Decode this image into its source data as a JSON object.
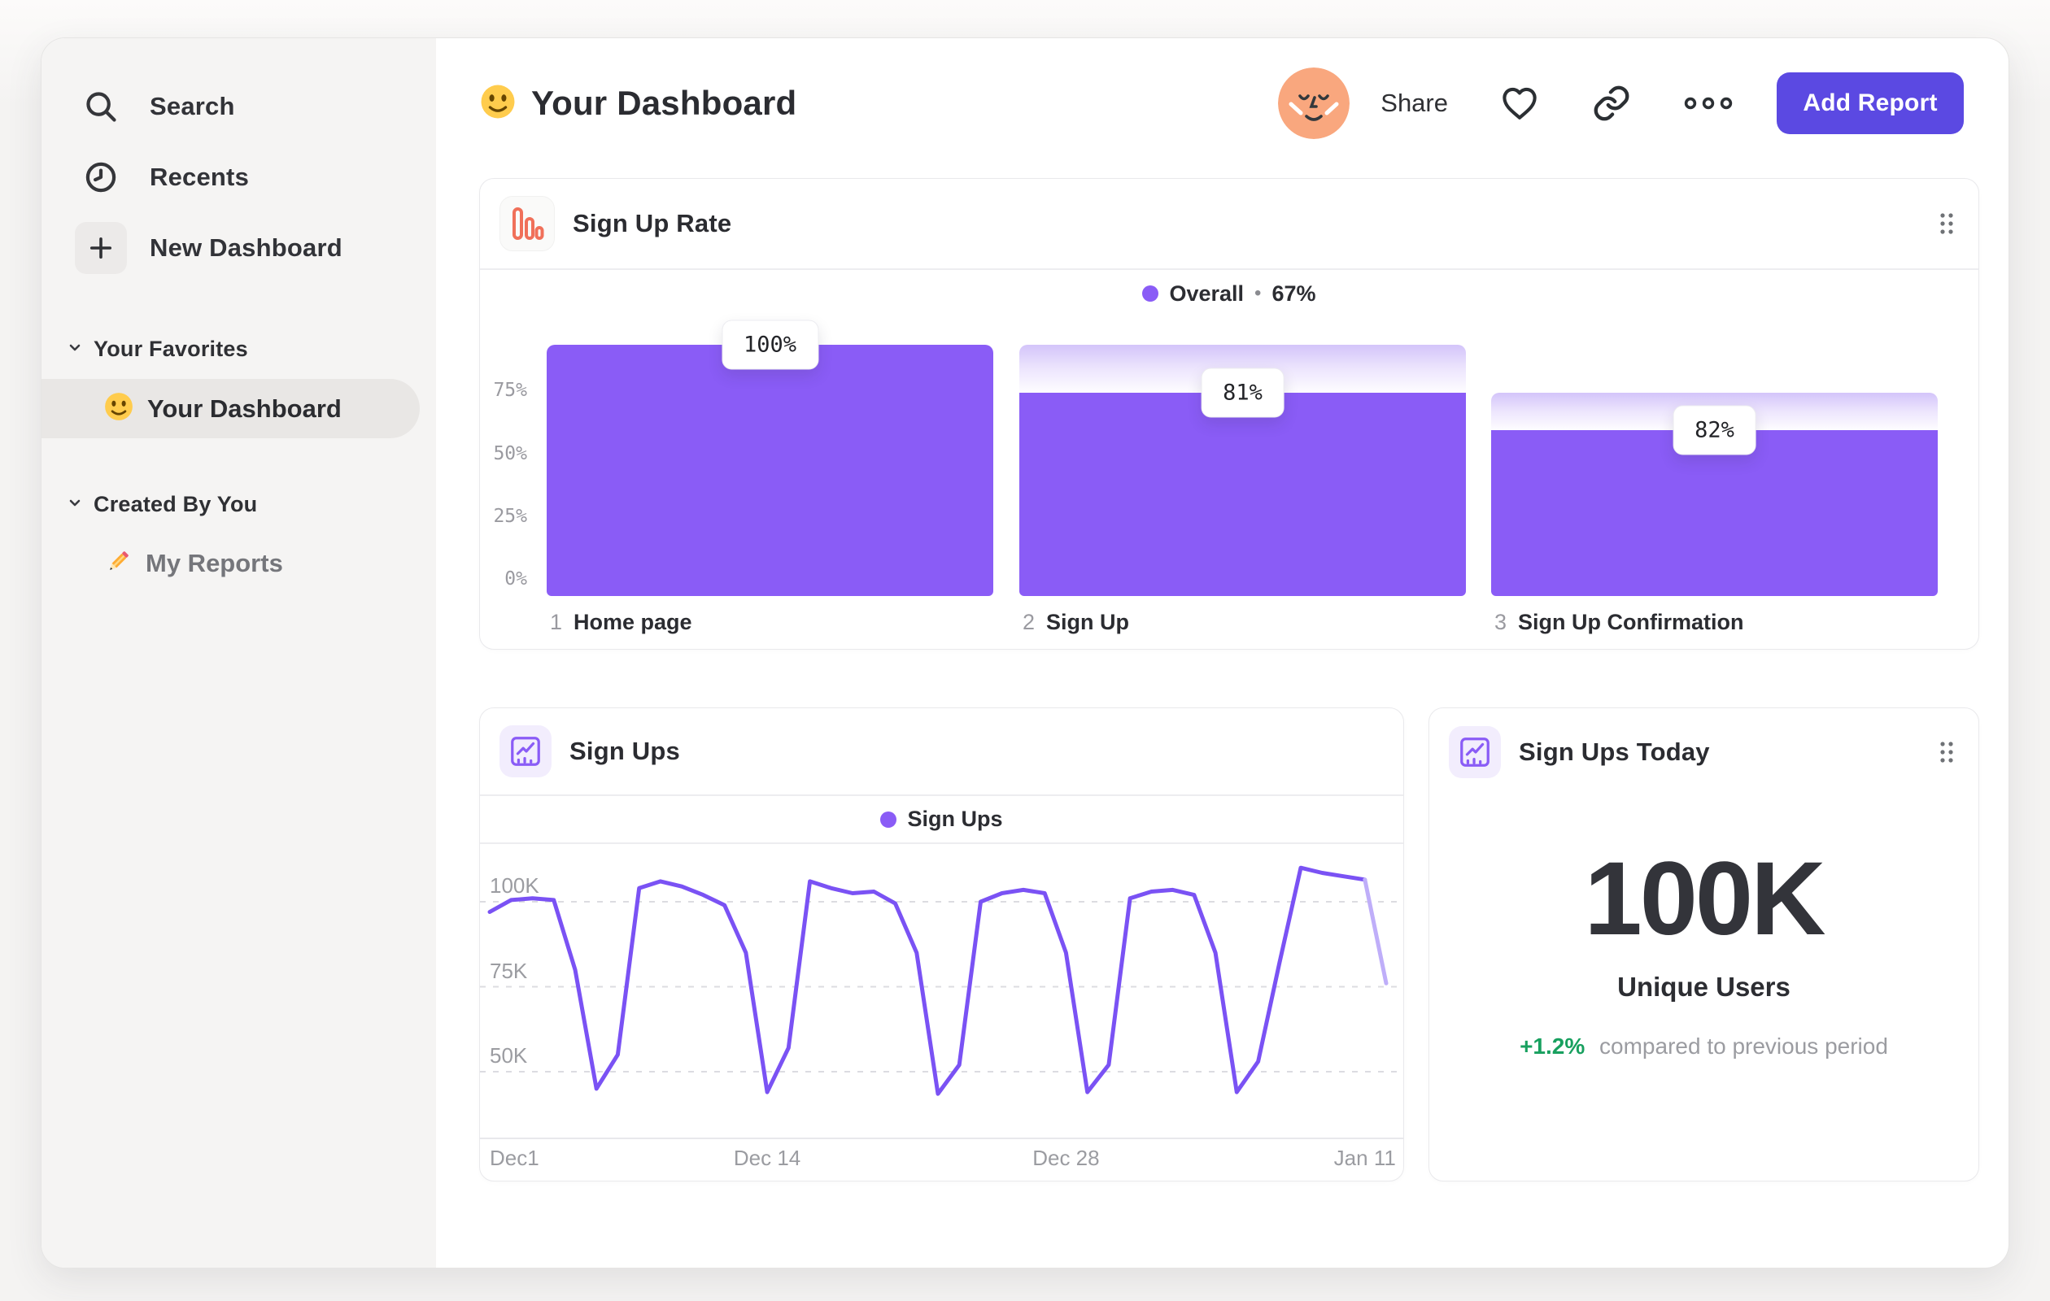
{
  "sidebar": {
    "items": [
      {
        "label": "Search",
        "icon": "search-icon"
      },
      {
        "label": "Recents",
        "icon": "clock-icon"
      },
      {
        "label": "New Dashboard",
        "icon": "plus-icon"
      }
    ],
    "sections": [
      {
        "title": "Your Favorites",
        "items": [
          {
            "label": "Your Dashboard",
            "emoji": "smiley",
            "selected": true
          }
        ]
      },
      {
        "title": "Created By You",
        "items": [
          {
            "label": "My Reports",
            "emoji": "pencil",
            "selected": false
          }
        ]
      }
    ]
  },
  "header": {
    "title": "Your Dashboard",
    "share_label": "Share",
    "add_report_label": "Add Report"
  },
  "cards": {
    "funnel": {
      "title": "Sign Up Rate",
      "legend": {
        "label": "Overall",
        "sep": "•",
        "value": "67%"
      }
    },
    "line": {
      "title": "Sign Ups",
      "legend": {
        "label": "Sign Ups"
      }
    },
    "metric": {
      "title": "Sign Ups Today",
      "value": "100K",
      "label": "Unique Users",
      "delta": "+1.2%",
      "delta_note": "compared to previous period"
    }
  },
  "chart_data": [
    {
      "type": "bar",
      "subtype": "funnel",
      "title": "Sign Up Rate",
      "legend": "Overall • 67%",
      "overall_pct": 67,
      "steps": [
        {
          "step": 1,
          "label": "Home page",
          "conversion_pct": 100,
          "cumulative_pct": 100
        },
        {
          "step": 2,
          "label": "Sign Up",
          "conversion_pct": 81,
          "cumulative_pct": 81
        },
        {
          "step": 3,
          "label": "Sign Up Confirmation",
          "conversion_pct": 82,
          "cumulative_pct": 66
        }
      ],
      "yticks": [
        "75%",
        "50%",
        "25%",
        "0%"
      ],
      "ytick_values": [
        75,
        50,
        25,
        0
      ],
      "ylim": [
        0,
        100
      ],
      "bar_color": "#8A5CF6",
      "dropoff_gradient": [
        "#D3C4FA",
        "#FFFFFF"
      ]
    },
    {
      "type": "line",
      "title": "Sign Ups",
      "series": [
        {
          "name": "Sign Ups",
          "values_thousands": [
            97,
            100.5,
            101,
            100.5,
            80,
            45,
            55,
            104,
            106,
            104.5,
            102,
            99,
            85,
            44,
            57,
            106,
            104,
            102.5,
            103,
            99.5,
            85,
            43.5,
            52,
            100,
            102.5,
            103.5,
            102.5,
            85,
            44,
            52,
            101,
            103,
            103.5,
            102,
            85,
            44,
            53,
            82,
            110,
            108.5,
            107.5,
            106.5,
            76
          ]
        }
      ],
      "x_tick_labels": [
        "Dec1",
        "Dec 14",
        "Dec 28",
        "Jan 11"
      ],
      "x_tick_positions": [
        0,
        13,
        27,
        41
      ],
      "yticks": [
        "100K",
        "75K",
        "50K"
      ],
      "ytick_values": [
        100,
        75,
        50
      ],
      "unit": "thousands",
      "grid": "dashed-horizontal",
      "line_color": "#7A52F4",
      "faded_tail_color": "#BFAEF9",
      "faded_tail_points": 1,
      "legend_position": "top-center"
    }
  ],
  "colors": {
    "accent_purple": "#8A5CF6",
    "button_purple": "#5B49E2",
    "line_purple": "#7A52F4",
    "line_faded": "#BFAEF9",
    "delta_green": "#18A05F",
    "funnel_icon_orange": "#F0705A",
    "avatar_peach": "#F9A77E",
    "sidebar_bg": "#F5F4F3",
    "selected_pill_bg": "#E9E7E5",
    "page_bg": "#F4F3F2"
  }
}
